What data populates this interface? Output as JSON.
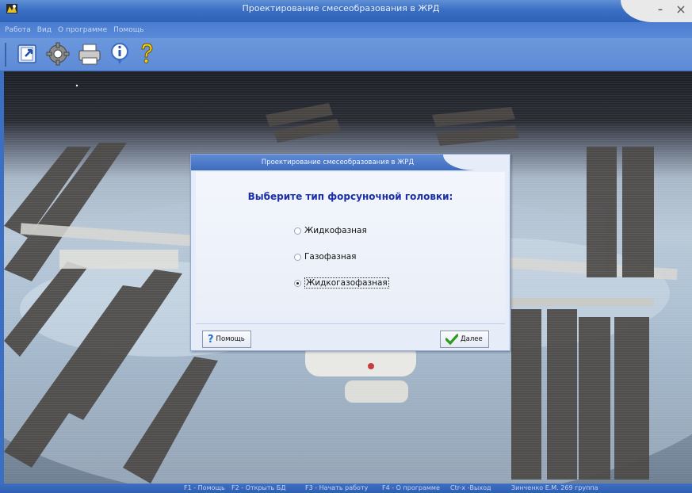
{
  "window": {
    "title": "Проектирование смесеобразования в ЖРД",
    "controls": {
      "minimize": "-",
      "close": "×"
    }
  },
  "menu": {
    "items": [
      "Работа",
      "Вид",
      "О программе",
      "Помощь"
    ]
  },
  "toolbar": {
    "buttons": [
      {
        "icon": "open-db-icon"
      },
      {
        "icon": "gear-icon"
      },
      {
        "icon": "printer-icon"
      },
      {
        "icon": "info-icon"
      },
      {
        "icon": "question-icon"
      }
    ]
  },
  "dialog": {
    "title": "Проектирование смесеобразования в ЖРД",
    "heading": "Выберите тип форсуночной головки:",
    "options": [
      {
        "label": "Жидкофазная",
        "checked": false
      },
      {
        "label": "Газофазная",
        "checked": false
      },
      {
        "label": "Жидкогазофазная",
        "checked": true
      }
    ],
    "help_label": "Помощь",
    "next_label": "Далее"
  },
  "statusbar": {
    "items": [
      "F1 - Помощь",
      "F2 - Открыть БД",
      "F3 - Начать работу",
      "F4 - О программе",
      "Ctr-x -Выход",
      "Зинченко Е.М. 269 группа"
    ]
  },
  "colors": {
    "title_blue": "#3a6fc4",
    "heading_blue": "#1a2fa8",
    "dialog_bg": "#e6ecf8"
  }
}
